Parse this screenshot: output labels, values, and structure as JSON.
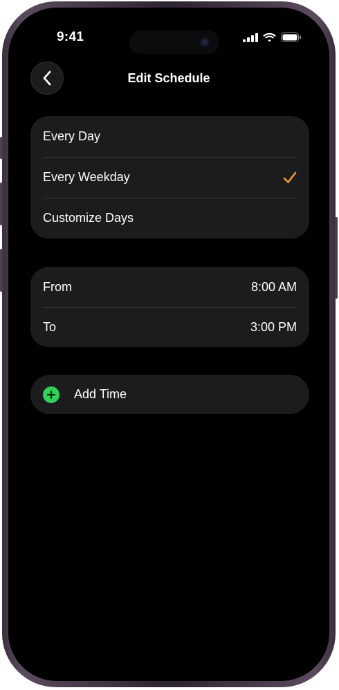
{
  "status_bar": {
    "time": "9:41"
  },
  "nav": {
    "title": "Edit Schedule",
    "back_icon": "chevron-left-icon"
  },
  "repeat_options": [
    {
      "label": "Every Day",
      "selected": false
    },
    {
      "label": "Every Weekday",
      "selected": true
    },
    {
      "label": "Customize Days",
      "selected": false
    }
  ],
  "time_range": {
    "from_label": "From",
    "from_value": "8:00 AM",
    "to_label": "To",
    "to_value": "3:00 PM"
  },
  "add_time": {
    "label": "Add Time",
    "icon": "plus-circle-icon"
  },
  "colors": {
    "accent_check": "#f19a37",
    "add_green": "#30d158",
    "cell_background": "#1c1c1e"
  }
}
